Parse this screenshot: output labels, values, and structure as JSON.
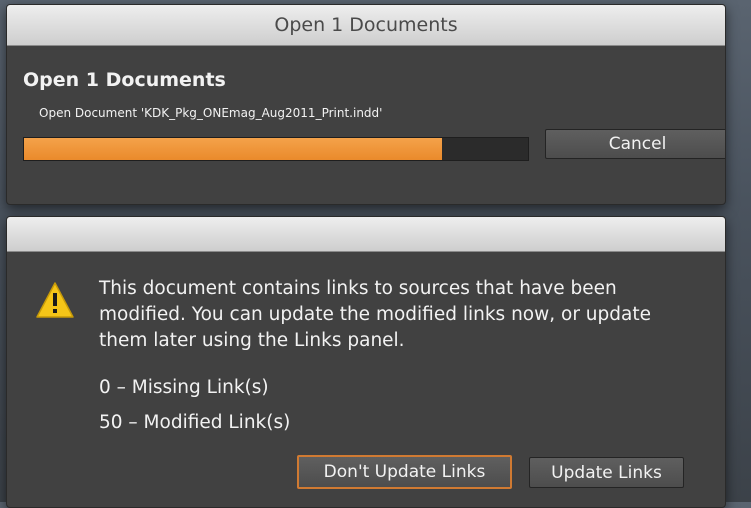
{
  "progress_dialog": {
    "title": "Open 1 Documents",
    "heading": "Open 1 Documents",
    "status": "Open Document 'KDK_Pkg_ONEmag_Aug2011_Print.indd'",
    "progress": 0.83,
    "cancel_label": "Cancel"
  },
  "alert_dialog": {
    "icon": "warning-icon",
    "message": "This document contains links to sources that have been modified. You can update the modified links now, or update them later using the Links panel.",
    "missing_links": "0 – Missing Link(s)",
    "modified_links": "50 – Modified Link(s)",
    "dont_update_label": "Don't Update Links",
    "update_label": "Update Links"
  },
  "colors": {
    "accent_orange": "#ea8a2b",
    "panel_bg": "#414141",
    "warning_yellow": "#f5c518"
  }
}
